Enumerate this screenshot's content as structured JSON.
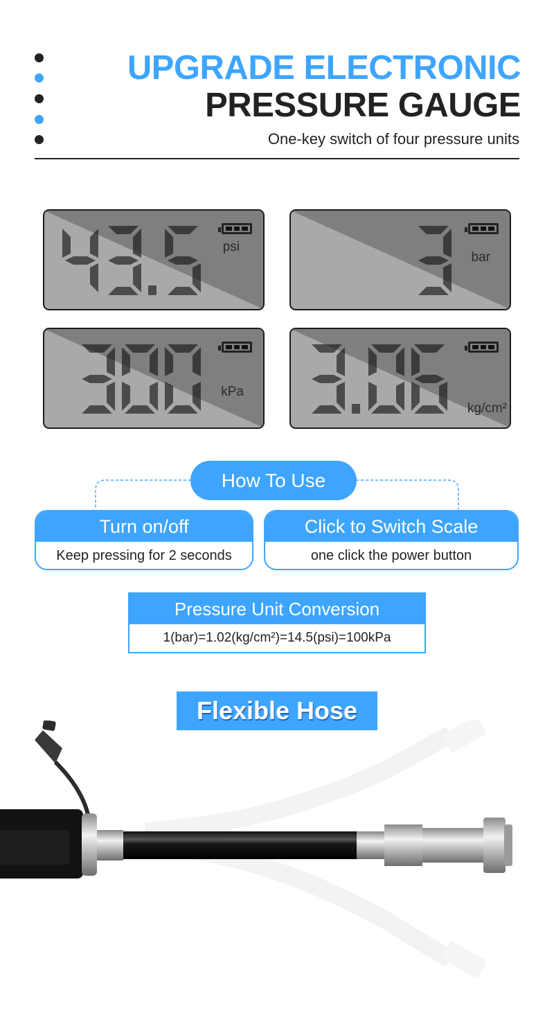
{
  "header": {
    "title_line1": "UPGRADE ELECTRONIC",
    "title_line2": "PRESSURE GAUGE",
    "subtitle": "One-key switch of four pressure units",
    "accent_color": "#3ea5ff",
    "dark_color": "#222222",
    "bullet_colors": [
      "#222222",
      "#3ea5ff",
      "#222222",
      "#3ea5ff",
      "#222222"
    ]
  },
  "displays": [
    {
      "value": "43.5",
      "unit": "psi",
      "battery_level": "3/3"
    },
    {
      "value": "3",
      "unit": "bar",
      "battery_level": "3/3"
    },
    {
      "value": "300",
      "unit": "kPa",
      "battery_level": "3/3"
    },
    {
      "value": "3.06",
      "unit": "kg/cm²",
      "battery_level": "3/3"
    }
  ],
  "how_to_use": {
    "title": "How To Use",
    "steps": [
      {
        "title": "Turn on/off",
        "desc": "Keep pressing for 2 seconds"
      },
      {
        "title": "Click to Switch Scale",
        "desc": "one click the power button"
      }
    ]
  },
  "conversion": {
    "title": "Pressure Unit Conversion",
    "formula": "1(bar)=1.02(kg/cm²)=14.5(psi)=100kPa"
  },
  "hose": {
    "label": "Flexible Hose"
  }
}
